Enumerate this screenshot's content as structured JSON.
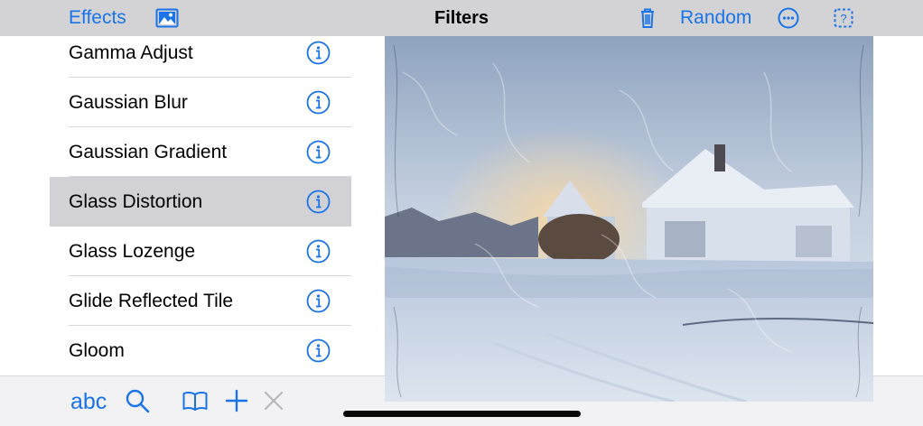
{
  "nav": {
    "effects_label": "Effects",
    "title": "Filters",
    "random_label": "Random",
    "icons": [
      "photo-icon",
      "trash-icon",
      "more-icon",
      "random-help-icon"
    ]
  },
  "filters": {
    "items": [
      {
        "label": "Gamma Adjust",
        "selected": false
      },
      {
        "label": "Gaussian Blur",
        "selected": false
      },
      {
        "label": "Gaussian Gradient",
        "selected": false
      },
      {
        "label": "Glass Distortion",
        "selected": true
      },
      {
        "label": "Glass Lozenge",
        "selected": false
      },
      {
        "label": "Glide Reflected Tile",
        "selected": false
      },
      {
        "label": "Gloom",
        "selected": false
      }
    ]
  },
  "toolbar": {
    "abc_label": "abc",
    "icons": [
      "search-icon",
      "book-icon",
      "plus-icon",
      "close-icon"
    ]
  },
  "colors": {
    "accent": "#1a73e8",
    "navbar_bg": "#d3d3d5",
    "selected_row": "#d1d1d6",
    "toolbar_bg": "#f2f2f4"
  }
}
